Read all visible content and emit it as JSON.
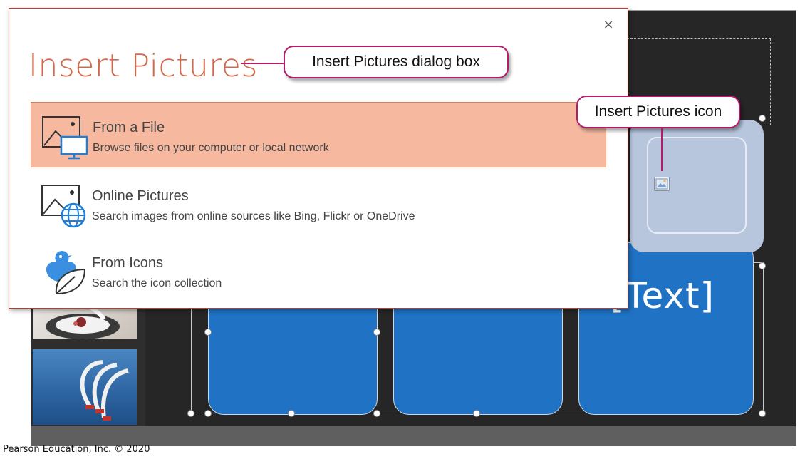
{
  "dialog": {
    "title": "Insert Pictures",
    "close_label": "×",
    "options": [
      {
        "title": "From a File",
        "description": "Browse files on your computer or local network",
        "icon": "picture-monitor-icon",
        "selected": true
      },
      {
        "title": "Online Pictures",
        "description": "Search images from online sources like Bing, Flickr or OneDrive",
        "icon": "picture-globe-icon",
        "selected": false
      },
      {
        "title": "From Icons",
        "description": "Search the icon collection",
        "icon": "bird-leaf-icon",
        "selected": false
      }
    ]
  },
  "slide": {
    "tile_text": "[Text]",
    "placeholder_icon": "insert-pictures-icon"
  },
  "callouts": {
    "dialog_box": "Insert Pictures dialog box",
    "icon": "Insert Pictures icon"
  },
  "copyright": "Pearson Education, Inc. © 2020",
  "colors": {
    "dialog_title": "#d4694a",
    "selected_option_bg": "#f6b99f",
    "selected_option_border": "#e07b52",
    "callout_border": "#b51b6b",
    "tile_blue": "#1f72c4",
    "placeholder_blue": "#b8c6dd"
  }
}
